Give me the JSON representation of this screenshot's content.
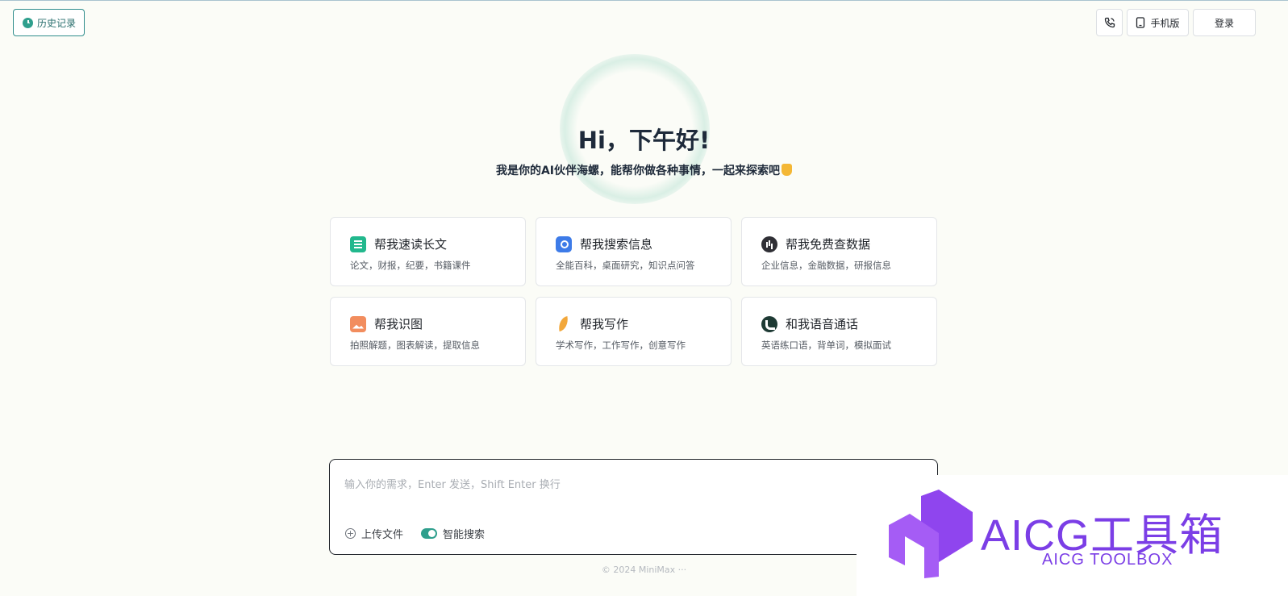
{
  "header": {
    "history_label": "历史记录",
    "mobile_label": "手机版",
    "login_label": "登录"
  },
  "hero": {
    "greeting": "Hi，下午好!",
    "subtitle": "我是你的AI伙伴海螺，能帮你做各种事情，一起来探索吧"
  },
  "cards": [
    {
      "title": "帮我速读长文",
      "desc": "论文，财报，纪要，书籍课件",
      "icon": "read-document-icon"
    },
    {
      "title": "帮我搜索信息",
      "desc": "全能百科，桌面研究，知识点问答",
      "icon": "search-document-icon"
    },
    {
      "title": "帮我免费查数据",
      "desc": "企业信息，金融数据，研报信息",
      "icon": "chart-data-icon"
    },
    {
      "title": "帮我识图",
      "desc": "拍照解题，图表解读，提取信息",
      "icon": "image-icon"
    },
    {
      "title": "帮我写作",
      "desc": "学术写作，工作写作，创意写作",
      "icon": "feather-pen-icon"
    },
    {
      "title": "和我语音通话",
      "desc": "英语练口语，背单词，模拟面试",
      "icon": "voice-call-icon"
    }
  ],
  "input": {
    "placeholder": "输入你的需求，Enter 发送，Shift Enter 换行",
    "upload_label": "上传文件",
    "smart_search_label": "智能搜索",
    "smart_search_on": true
  },
  "footer": {
    "text": "© 2024 MiniMax ···"
  },
  "watermark": {
    "title": "AICG工具箱",
    "subtitle": "AICG TOOLBOX"
  },
  "colors": {
    "accent": "#2f9f8d",
    "background": "#fbfcf7",
    "watermark": "#7b3ee6"
  }
}
